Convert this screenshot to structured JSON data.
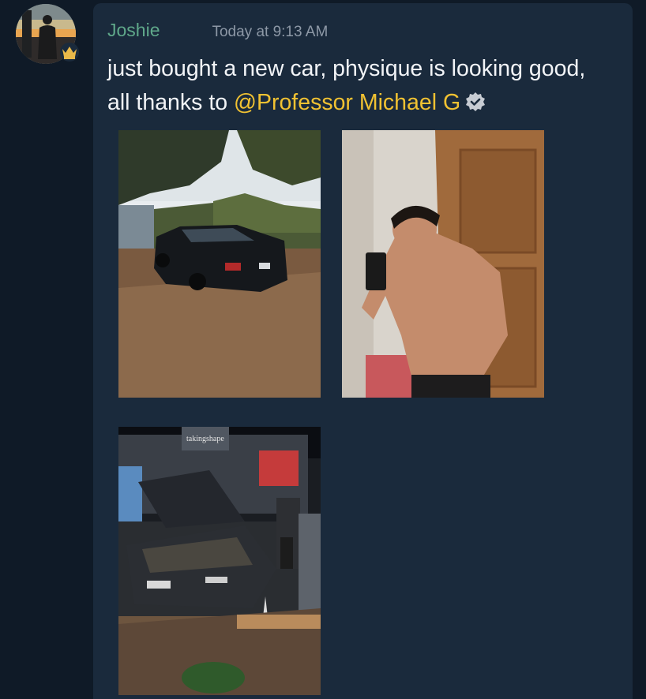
{
  "message": {
    "username": "Joshie",
    "timestamp": "Today at 9:13 AM",
    "text_before": "just bought a new car, physique is looking good, all thanks to ",
    "mention": "@Professor Michael G"
  },
  "attachments": [
    {
      "kind": "photo",
      "subject": "black sedan parked on dirt driveway"
    },
    {
      "kind": "photo",
      "subject": "mirror selfie"
    },
    {
      "kind": "photo",
      "subject": "car with open hood at night in parking lot",
      "sign_text": "takingshape"
    }
  ],
  "icons": {
    "avatar_badge": "crown-icon",
    "verified": "verified-badge-icon"
  },
  "colors": {
    "background": "#0f1a27",
    "card": "#1a2a3c",
    "username": "#5fa88a",
    "timestamp": "#8d98a6",
    "text": "#f2f4f7",
    "mention": "#f1c232"
  }
}
